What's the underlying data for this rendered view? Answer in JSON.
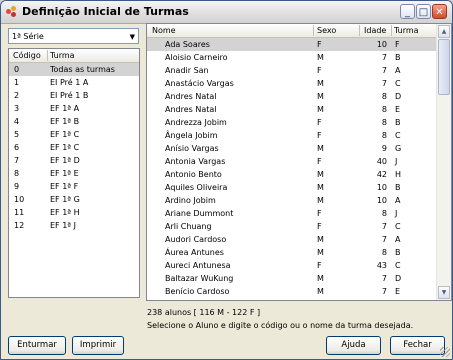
{
  "window": {
    "title": "Definição Inicial de Turmas",
    "minimize": "_",
    "maximize": "□",
    "close": "✕"
  },
  "combo": {
    "value": "1ª Série"
  },
  "left_grid": {
    "headers": [
      "Código",
      "Turma"
    ],
    "rows": [
      [
        "0",
        "Todas as turmas"
      ],
      [
        "1",
        "EI Pré 1 A"
      ],
      [
        "2",
        "EI Pré 1 B"
      ],
      [
        "3",
        "EF 1ª A"
      ],
      [
        "4",
        "EF 1ª B"
      ],
      [
        "5",
        "EF 1ª C"
      ],
      [
        "6",
        "EF 1ª C"
      ],
      [
        "7",
        "EF 1ª D"
      ],
      [
        "8",
        "EF 1ª E"
      ],
      [
        "9",
        "EF 1ª F"
      ],
      [
        "10",
        "EF 1ª G"
      ],
      [
        "11",
        "EF 1ª H"
      ],
      [
        "12",
        "EF 1ª J"
      ]
    ]
  },
  "right_grid": {
    "headers": [
      "Nome",
      "Sexo",
      "Idade",
      "Turma"
    ],
    "rows": [
      [
        "Ada Soares",
        "F",
        "10",
        "F"
      ],
      [
        "Aloisio Carneiro",
        "M",
        "7",
        "B"
      ],
      [
        "Anadir San",
        "F",
        "7",
        "A"
      ],
      [
        "Anastácio Vargas",
        "M",
        "7",
        "C"
      ],
      [
        "Andres Natal",
        "M",
        "8",
        "D"
      ],
      [
        "Andres Natal",
        "M",
        "8",
        "E"
      ],
      [
        "Andrezza Jobim",
        "F",
        "8",
        "B"
      ],
      [
        "Ângela Jobim",
        "F",
        "8",
        "C"
      ],
      [
        "Anísio Vargas",
        "M",
        "9",
        "G"
      ],
      [
        "Antonia Vargas",
        "F",
        "40",
        "J"
      ],
      [
        "Antonio Bento",
        "M",
        "42",
        "H"
      ],
      [
        "Aquiles Oliveira",
        "M",
        "10",
        "B"
      ],
      [
        "Ardino Jobim",
        "M",
        "10",
        "A"
      ],
      [
        "Ariane Dummont",
        "F",
        "8",
        "J"
      ],
      [
        "Arli Chuang",
        "F",
        "7",
        "C"
      ],
      [
        "Audori Cardoso",
        "M",
        "7",
        "A"
      ],
      [
        "Áurea Antunes",
        "M",
        "8",
        "B"
      ],
      [
        "Aureci Antunesa",
        "F",
        "43",
        "C"
      ],
      [
        "Baltazar WuKung",
        "M",
        "7",
        "D"
      ],
      [
        "Benício Cardoso",
        "M",
        "7",
        "E"
      ]
    ]
  },
  "status": {
    "count": "238 alunos [ 116 M - 122 F ]",
    "hint": "Selecione o Aluno e digite o código ou o nome da turma desejada."
  },
  "buttons": {
    "enturmar": "Enturmar",
    "imprimir": "Imprimir",
    "ajuda": "Ajuda",
    "fechar": "Fechar"
  },
  "colors": {
    "selected_row": "#d3d3d3",
    "close_button": "#d24a2a",
    "window_border": "#3a5a8a"
  }
}
